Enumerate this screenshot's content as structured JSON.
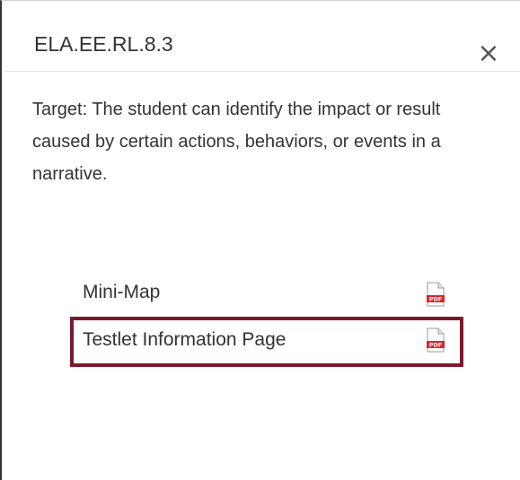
{
  "modal": {
    "title": "ELA.EE.RL.8.3",
    "close_symbol": "×",
    "target_text": "Target: The student can identify the impact or result caused by certain actions, behaviors, or events in a narrative.",
    "resources": [
      {
        "label": "Mini-Map",
        "icon": "pdf-file-icon",
        "highlighted": false
      },
      {
        "label": "Testlet Information Page",
        "icon": "pdf-file-icon",
        "highlighted": true
      }
    ],
    "pdf_badge_text": "PDF"
  },
  "colors": {
    "highlight_border": "#7b1a2b",
    "pdf_red": "#d9262b",
    "text": "#333333"
  }
}
